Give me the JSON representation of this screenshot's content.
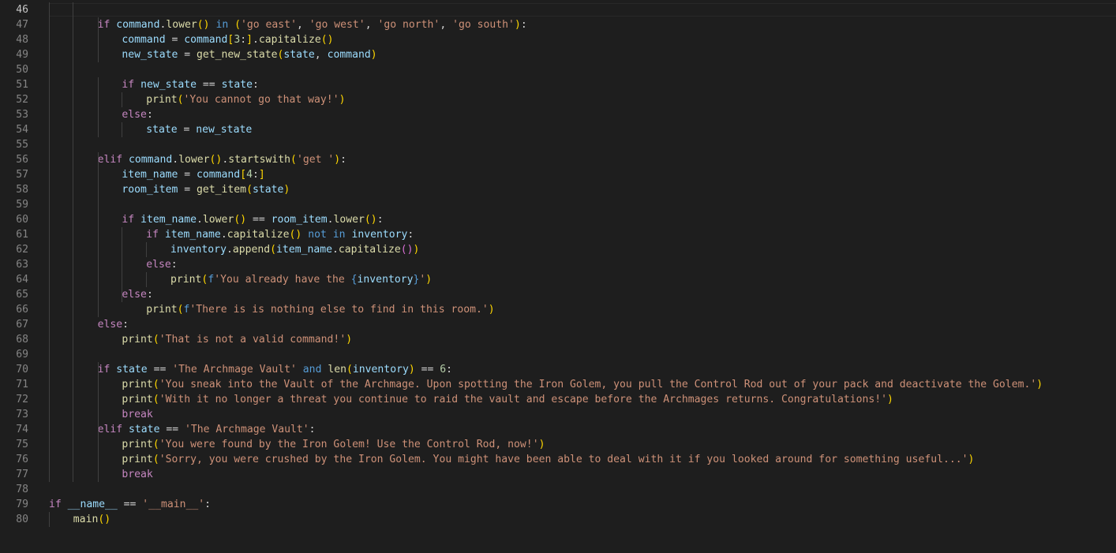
{
  "editor": {
    "first_line": 46,
    "active_line": 46,
    "lines": [
      {
        "n": "46",
        "tokens": []
      },
      {
        "n": "47",
        "indent": 2,
        "tokens": [
          [
            "ctl",
            "if"
          ],
          [
            "op",
            " "
          ],
          [
            "var",
            "command"
          ],
          [
            "op",
            "."
          ],
          [
            "fn",
            "lower"
          ],
          [
            "br1",
            "()"
          ],
          [
            "op",
            " "
          ],
          [
            "kw",
            "in"
          ],
          [
            "op",
            " "
          ],
          [
            "br1",
            "("
          ],
          [
            "str",
            "'go east'"
          ],
          [
            "op",
            ", "
          ],
          [
            "str",
            "'go west'"
          ],
          [
            "op",
            ", "
          ],
          [
            "str",
            "'go north'"
          ],
          [
            "op",
            ", "
          ],
          [
            "str",
            "'go south'"
          ],
          [
            "br1",
            ")"
          ],
          [
            "op",
            ":"
          ]
        ]
      },
      {
        "n": "48",
        "indent": 3,
        "tokens": [
          [
            "var",
            "command"
          ],
          [
            "op",
            " = "
          ],
          [
            "var",
            "command"
          ],
          [
            "br1",
            "["
          ],
          [
            "num",
            "3"
          ],
          [
            "op",
            ":"
          ],
          [
            "br1",
            "]"
          ],
          [
            "op",
            "."
          ],
          [
            "fn",
            "capitalize"
          ],
          [
            "br1",
            "()"
          ]
        ]
      },
      {
        "n": "49",
        "indent": 3,
        "tokens": [
          [
            "var",
            "new_state"
          ],
          [
            "op",
            " = "
          ],
          [
            "fn",
            "get_new_state"
          ],
          [
            "br1",
            "("
          ],
          [
            "var",
            "state"
          ],
          [
            "op",
            ", "
          ],
          [
            "var",
            "command"
          ],
          [
            "br1",
            ")"
          ]
        ]
      },
      {
        "n": "50",
        "tokens": []
      },
      {
        "n": "51",
        "indent": 3,
        "tokens": [
          [
            "ctl",
            "if"
          ],
          [
            "op",
            " "
          ],
          [
            "var",
            "new_state"
          ],
          [
            "op",
            " == "
          ],
          [
            "var",
            "state"
          ],
          [
            "op",
            ":"
          ]
        ]
      },
      {
        "n": "52",
        "indent": 4,
        "tokens": [
          [
            "fn",
            "print"
          ],
          [
            "br1",
            "("
          ],
          [
            "str",
            "'You cannot go that way!'"
          ],
          [
            "br1",
            ")"
          ]
        ]
      },
      {
        "n": "53",
        "indent": 3,
        "tokens": [
          [
            "ctl",
            "else"
          ],
          [
            "op",
            ":"
          ]
        ]
      },
      {
        "n": "54",
        "indent": 4,
        "tokens": [
          [
            "var",
            "state"
          ],
          [
            "op",
            " = "
          ],
          [
            "var",
            "new_state"
          ]
        ]
      },
      {
        "n": "55",
        "tokens": []
      },
      {
        "n": "56",
        "indent": 2,
        "tokens": [
          [
            "ctl",
            "elif"
          ],
          [
            "op",
            " "
          ],
          [
            "var",
            "command"
          ],
          [
            "op",
            "."
          ],
          [
            "fn",
            "lower"
          ],
          [
            "br1",
            "()"
          ],
          [
            "op",
            "."
          ],
          [
            "fn",
            "startswith"
          ],
          [
            "br1",
            "("
          ],
          [
            "str",
            "'get '"
          ],
          [
            "br1",
            ")"
          ],
          [
            "op",
            ":"
          ]
        ]
      },
      {
        "n": "57",
        "indent": 3,
        "tokens": [
          [
            "var",
            "item_name"
          ],
          [
            "op",
            " = "
          ],
          [
            "var",
            "command"
          ],
          [
            "br1",
            "["
          ],
          [
            "num",
            "4"
          ],
          [
            "op",
            ":"
          ],
          [
            "br1",
            "]"
          ]
        ]
      },
      {
        "n": "58",
        "indent": 3,
        "tokens": [
          [
            "var",
            "room_item"
          ],
          [
            "op",
            " = "
          ],
          [
            "fn",
            "get_item"
          ],
          [
            "br1",
            "("
          ],
          [
            "var",
            "state"
          ],
          [
            "br1",
            ")"
          ]
        ]
      },
      {
        "n": "59",
        "tokens": []
      },
      {
        "n": "60",
        "indent": 3,
        "tokens": [
          [
            "ctl",
            "if"
          ],
          [
            "op",
            " "
          ],
          [
            "var",
            "item_name"
          ],
          [
            "op",
            "."
          ],
          [
            "fn",
            "lower"
          ],
          [
            "br1",
            "()"
          ],
          [
            "op",
            " == "
          ],
          [
            "var",
            "room_item"
          ],
          [
            "op",
            "."
          ],
          [
            "fn",
            "lower"
          ],
          [
            "br1",
            "()"
          ],
          [
            "op",
            ":"
          ]
        ]
      },
      {
        "n": "61",
        "indent": 4,
        "tokens": [
          [
            "ctl",
            "if"
          ],
          [
            "op",
            " "
          ],
          [
            "var",
            "item_name"
          ],
          [
            "op",
            "."
          ],
          [
            "fn",
            "capitalize"
          ],
          [
            "br1",
            "()"
          ],
          [
            "op",
            " "
          ],
          [
            "kw",
            "not"
          ],
          [
            "op",
            " "
          ],
          [
            "kw",
            "in"
          ],
          [
            "op",
            " "
          ],
          [
            "var",
            "inventory"
          ],
          [
            "op",
            ":"
          ]
        ]
      },
      {
        "n": "62",
        "indent": 5,
        "tokens": [
          [
            "var",
            "inventory"
          ],
          [
            "op",
            "."
          ],
          [
            "fn",
            "append"
          ],
          [
            "br1",
            "("
          ],
          [
            "var",
            "item_name"
          ],
          [
            "op",
            "."
          ],
          [
            "fn",
            "capitalize"
          ],
          [
            "br2",
            "()"
          ],
          [
            "br1",
            ")"
          ]
        ]
      },
      {
        "n": "63",
        "indent": 4,
        "tokens": [
          [
            "ctl",
            "else"
          ],
          [
            "op",
            ":"
          ]
        ]
      },
      {
        "n": "64",
        "indent": 5,
        "tokens": [
          [
            "fn",
            "print"
          ],
          [
            "br1",
            "("
          ],
          [
            "kw",
            "f"
          ],
          [
            "str",
            "'You already have the "
          ],
          [
            "kw",
            "{"
          ],
          [
            "var",
            "inventory"
          ],
          [
            "kw",
            "}"
          ],
          [
            "str",
            "'"
          ],
          [
            "br1",
            ")"
          ]
        ]
      },
      {
        "n": "65",
        "indent": 3,
        "tokens": [
          [
            "ctl",
            "else"
          ],
          [
            "op",
            ":"
          ]
        ]
      },
      {
        "n": "66",
        "indent": 4,
        "tokens": [
          [
            "fn",
            "print"
          ],
          [
            "br1",
            "("
          ],
          [
            "kw",
            "f"
          ],
          [
            "str",
            "'There is is nothing else to find in this room.'"
          ],
          [
            "br1",
            ")"
          ]
        ]
      },
      {
        "n": "67",
        "indent": 2,
        "tokens": [
          [
            "ctl",
            "else"
          ],
          [
            "op",
            ":"
          ]
        ]
      },
      {
        "n": "68",
        "indent": 3,
        "tokens": [
          [
            "fn",
            "print"
          ],
          [
            "br1",
            "("
          ],
          [
            "str",
            "'That is not a valid command!'"
          ],
          [
            "br1",
            ")"
          ]
        ]
      },
      {
        "n": "69",
        "tokens": []
      },
      {
        "n": "70",
        "indent": 2,
        "tokens": [
          [
            "ctl",
            "if"
          ],
          [
            "op",
            " "
          ],
          [
            "var",
            "state"
          ],
          [
            "op",
            " == "
          ],
          [
            "str",
            "'The Archmage Vault'"
          ],
          [
            "op",
            " "
          ],
          [
            "kw",
            "and"
          ],
          [
            "op",
            " "
          ],
          [
            "fn",
            "len"
          ],
          [
            "br1",
            "("
          ],
          [
            "var",
            "inventory"
          ],
          [
            "br1",
            ")"
          ],
          [
            "op",
            " == "
          ],
          [
            "num",
            "6"
          ],
          [
            "op",
            ":"
          ]
        ]
      },
      {
        "n": "71",
        "indent": 3,
        "tokens": [
          [
            "fn",
            "print"
          ],
          [
            "br1",
            "("
          ],
          [
            "str",
            "'You sneak into the Vault of the Archmage. Upon spotting the Iron Golem, you pull the Control Rod out of your pack and deactivate the Golem.'"
          ],
          [
            "br1",
            ")"
          ]
        ]
      },
      {
        "n": "72",
        "indent": 3,
        "tokens": [
          [
            "fn",
            "print"
          ],
          [
            "br1",
            "("
          ],
          [
            "str",
            "'With it no longer a threat you continue to raid the vault and escape before the Archmages returns. Congratulations!'"
          ],
          [
            "br1",
            ")"
          ]
        ]
      },
      {
        "n": "73",
        "indent": 3,
        "tokens": [
          [
            "ctl",
            "break"
          ]
        ]
      },
      {
        "n": "74",
        "indent": 2,
        "tokens": [
          [
            "ctl",
            "elif"
          ],
          [
            "op",
            " "
          ],
          [
            "var",
            "state"
          ],
          [
            "op",
            " == "
          ],
          [
            "str",
            "'The Archmage Vault'"
          ],
          [
            "op",
            ":"
          ]
        ]
      },
      {
        "n": "75",
        "indent": 3,
        "tokens": [
          [
            "fn",
            "print"
          ],
          [
            "br1",
            "("
          ],
          [
            "str",
            "'You were found by the Iron Golem! Use the Control Rod, now!'"
          ],
          [
            "br1",
            ")"
          ]
        ]
      },
      {
        "n": "76",
        "indent": 3,
        "tokens": [
          [
            "fn",
            "print"
          ],
          [
            "br1",
            "("
          ],
          [
            "str",
            "'Sorry, you were crushed by the Iron Golem. You might have been able to deal with it if you looked around for something useful...'"
          ],
          [
            "br1",
            ")"
          ]
        ]
      },
      {
        "n": "77",
        "indent": 3,
        "tokens": [
          [
            "ctl",
            "break"
          ]
        ]
      },
      {
        "n": "78",
        "tokens": []
      },
      {
        "n": "79",
        "indent": 0,
        "tokens": [
          [
            "ctl",
            "if"
          ],
          [
            "op",
            " "
          ],
          [
            "var",
            "__name__"
          ],
          [
            "op",
            " == "
          ],
          [
            "str",
            "'__main__'"
          ],
          [
            "op",
            ":"
          ]
        ]
      },
      {
        "n": "80",
        "indent": 1,
        "tokens": [
          [
            "fn",
            "main"
          ],
          [
            "br1",
            "()"
          ]
        ]
      }
    ]
  },
  "colors": {
    "background": "#1e1e1e",
    "line_number": "#858585",
    "keyword": "#569cd6",
    "control": "#c586c0",
    "function": "#dcdcaa",
    "variable": "#9cdcfe",
    "string": "#ce9178",
    "number": "#b5cea8"
  }
}
